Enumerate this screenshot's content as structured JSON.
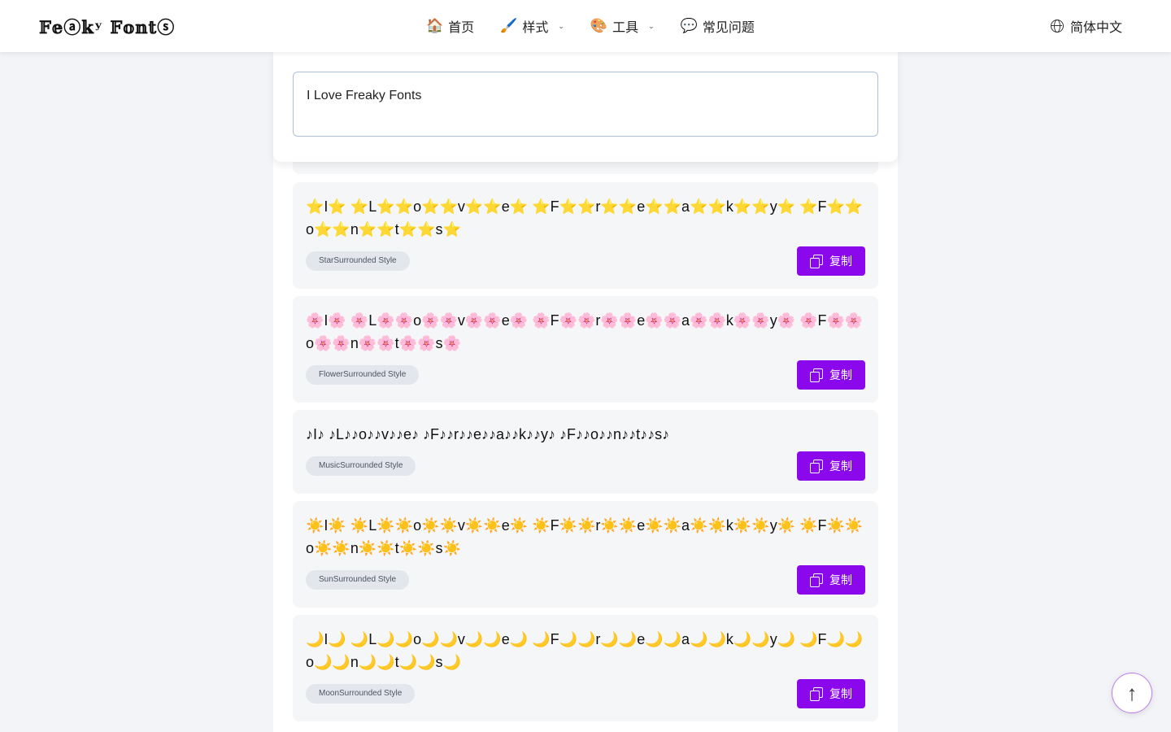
{
  "header": {
    "logo": "𝔽𝕖ⓐ𝕜ʸ 𝔽𝕠𝕟𝕥ⓢ",
    "nav": [
      {
        "emoji": "🏠",
        "label": "首页"
      },
      {
        "emoji": "🖌️",
        "label": "样式"
      },
      {
        "emoji": "🎨",
        "label": "工具"
      },
      {
        "emoji": "💬",
        "label": "常见问题"
      }
    ],
    "language": "简体中文"
  },
  "input": {
    "value": "I Love Freaky Fonts"
  },
  "copy_label": "复制",
  "results": [
    {
      "text": "⭐I⭐ ⭐L⭐⭐o⭐⭐v⭐⭐e⭐ ⭐F⭐⭐r⭐⭐e⭐⭐a⭐⭐k⭐⭐y⭐ ⭐F⭐⭐o⭐⭐n⭐⭐t⭐⭐s⭐",
      "style": "StarSurrounded Style"
    },
    {
      "text": "🌸I🌸 🌸L🌸🌸o🌸🌸v🌸🌸e🌸 🌸F🌸🌸r🌸🌸e🌸🌸a🌸🌸k🌸🌸y🌸 🌸F🌸🌸o🌸🌸n🌸🌸t🌸🌸s🌸",
      "style": "FlowerSurrounded Style"
    },
    {
      "text": "♪I♪ ♪L♪♪o♪♪v♪♪e♪ ♪F♪♪r♪♪e♪♪a♪♪k♪♪y♪ ♪F♪♪o♪♪n♪♪t♪♪s♪",
      "style": "MusicSurrounded Style"
    },
    {
      "text": "☀️I☀️ ☀️L☀️☀️o☀️☀️v☀️☀️e☀️ ☀️F☀️☀️r☀️☀️e☀️☀️a☀️☀️k☀️☀️y☀️ ☀️F☀️☀️o☀️☀️n☀️☀️t☀️☀️s☀️",
      "style": "SunSurrounded Style"
    },
    {
      "text": "🌙I🌙 🌙L🌙🌙o🌙🌙v🌙🌙e🌙 🌙F🌙🌙r🌙🌙e🌙🌙a🌙🌙k🌙🌙y🌙 🌙F🌙🌙o🌙🌙n🌙🌙t🌙🌙s🌙",
      "style": "MoonSurrounded Style"
    }
  ],
  "scroll_top_icon": "arrow-up-icon"
}
